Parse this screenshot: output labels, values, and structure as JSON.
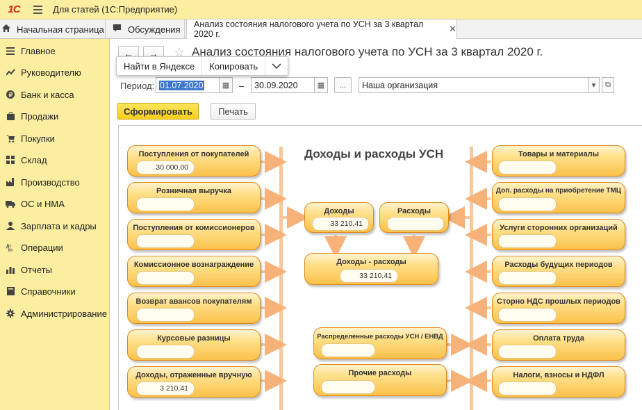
{
  "app": {
    "logo": "1С",
    "title": "Для статей  (1С:Предприятие)"
  },
  "tabs": [
    {
      "label": "Начальная страница",
      "icon": "home-icon"
    },
    {
      "label": "Обсуждения",
      "icon": "chat-icon"
    },
    {
      "label": "Анализ состояния налогового учета по УСН за 3 квартал 2020 г.",
      "icon": ""
    }
  ],
  "sidebar": {
    "items": [
      {
        "label": "Главное",
        "icon": "menu-list-icon"
      },
      {
        "label": "Руководителю",
        "icon": "trend-icon"
      },
      {
        "label": "Банк и касса",
        "icon": "ruble-icon"
      },
      {
        "label": "Продажи",
        "icon": "bag-icon"
      },
      {
        "label": "Покупки",
        "icon": "cart-icon"
      },
      {
        "label": "Склад",
        "icon": "boxes-icon"
      },
      {
        "label": "Производство",
        "icon": "factory-icon"
      },
      {
        "label": "ОС и НМА",
        "icon": "truck-icon"
      },
      {
        "label": "Зарплата и кадры",
        "icon": "person-icon"
      },
      {
        "label": "Операции",
        "icon": "dt-kt-icon"
      },
      {
        "label": "Отчеты",
        "icon": "chart-icon"
      },
      {
        "label": "Справочники",
        "icon": "book-icon"
      },
      {
        "label": "Администрирование",
        "icon": "gear-icon"
      }
    ]
  },
  "page": {
    "title": "Анализ состояния налогового учета по УСН за 3 квартал 2020 г.",
    "popup": {
      "find": "Найти в Яндексе",
      "copy": "Копировать"
    },
    "period_label": "Период:",
    "date_from": "01.07.2020",
    "dash": "–",
    "date_to": "30.09.2020",
    "dots": "...",
    "organization": "Наша организация",
    "generate": "Сформировать",
    "print": "Печать"
  },
  "diagram": {
    "title": "Доходы и расходы УСН",
    "left": [
      {
        "label": "Поступления от покупателей",
        "value": "30 000,00"
      },
      {
        "label": "Розничная выручка",
        "value": ""
      },
      {
        "label": "Поступления от комиссионеров",
        "value": ""
      },
      {
        "label": "Комиссионное вознаграждение",
        "value": ""
      },
      {
        "label": "Возврат авансов покупателям",
        "value": ""
      },
      {
        "label": "Курсовые разницы",
        "value": ""
      },
      {
        "label": "Доходы, отраженные вручную",
        "value": "3 210,41"
      }
    ],
    "right": [
      {
        "label": "Товары и материалы",
        "value": ""
      },
      {
        "label": "Доп. расходы на приобретение ТМЦ",
        "value": ""
      },
      {
        "label": "Услуги сторонних организаций",
        "value": ""
      },
      {
        "label": "Расходы будущих периодов",
        "value": ""
      },
      {
        "label": "Сторно НДС прошлых периодов",
        "value": ""
      },
      {
        "label": "Оплата труда",
        "value": ""
      },
      {
        "label": "Налоги, взносы и НДФЛ",
        "value": ""
      }
    ],
    "income": {
      "label": "Доходы",
      "value": "33 210,41"
    },
    "expense": {
      "label": "Расходы",
      "value": ""
    },
    "diff": {
      "label": "Доходы - расходы",
      "value": "33 210,41"
    },
    "distributed": {
      "label": "Распределенные расходы УСН / ЕНВД",
      "value": ""
    },
    "other": {
      "label": "Прочие расходы",
      "value": ""
    }
  },
  "colors": {
    "panel": "#fbeea0",
    "accent": "#f6cf1a",
    "block": "#fbc14a",
    "arrow": "#f9c89a"
  }
}
